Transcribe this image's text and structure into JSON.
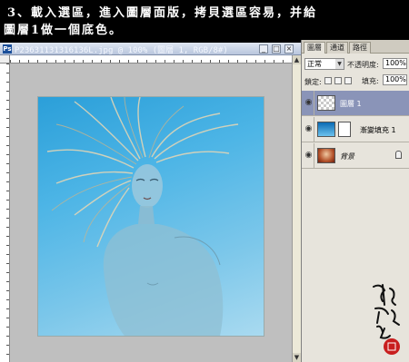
{
  "instruction": {
    "line1": "3、載入選區，進入圖層面版，拷貝選區容易，并給",
    "line2": "圖層1做一個底色。"
  },
  "document": {
    "title": "P23631131316136L.jpg @ 100% (圖層 1, RGB/8#)",
    "buttons": {
      "minimize": "_",
      "maximize": "□",
      "close": "×"
    }
  },
  "layers_panel": {
    "tabs": [
      "圖層",
      "通道",
      "路徑"
    ],
    "blend_mode": "正常",
    "opacity_label": "不透明度:",
    "opacity_value": "100%",
    "lock_label": "鎖定:",
    "fill_label": "填充:",
    "fill_value": "100%",
    "layers": [
      {
        "name": "圖層 1",
        "selected": true
      },
      {
        "name": "漸變填充 1",
        "selected": false
      },
      {
        "name": "背景",
        "selected": false
      }
    ]
  },
  "colors": {
    "selected_layer": "#8a94b8",
    "panel_bg": "#e7e4dc",
    "canvas_bg": "#bfbfbf",
    "gradient_top": "#2b9fd9",
    "gradient_bottom": "#a9daf0"
  }
}
